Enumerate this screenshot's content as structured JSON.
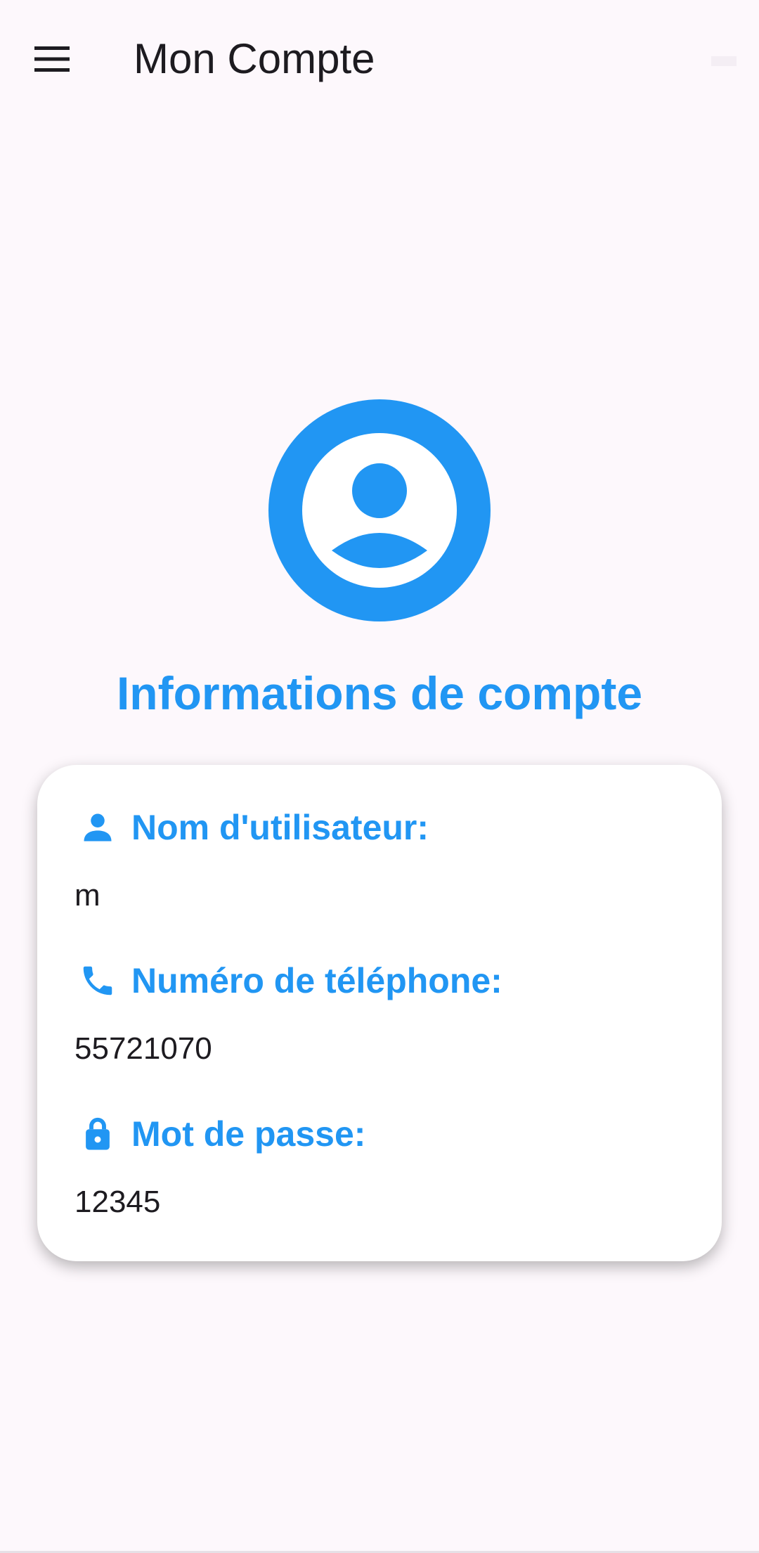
{
  "app_bar": {
    "title": "Mon Compte",
    "menu_icon": "menu-icon"
  },
  "header": {
    "avatar_icon": "account-circle-icon",
    "title": "Informations de compte"
  },
  "account_info": {
    "username": {
      "icon": "person-icon",
      "label": "Nom d'utilisateur:",
      "value": "m"
    },
    "phone": {
      "icon": "phone-icon",
      "label": "Numéro de téléphone:",
      "value": "55721070"
    },
    "password": {
      "icon": "lock-icon",
      "label": "Mot de passe:",
      "value": "12345"
    }
  },
  "colors": {
    "accent": "#2196f3",
    "background": "#fdf8fc",
    "card": "#ffffff",
    "text": "#1d1b20"
  }
}
